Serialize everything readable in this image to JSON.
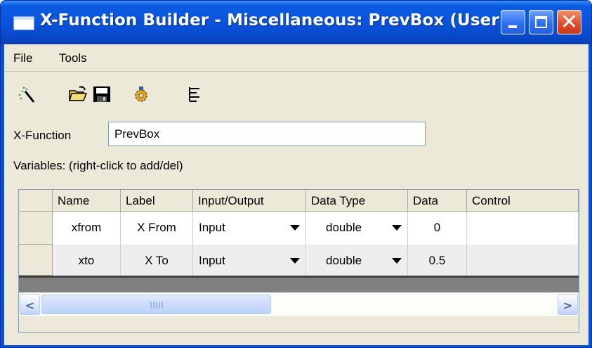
{
  "window": {
    "title": "X-Function Builder - Miscellaneous: PrevBox (User)"
  },
  "menu": [
    "File",
    "Tools"
  ],
  "toolbar": {
    "icons": [
      "wand-icon",
      "open-folder-icon",
      "save-icon",
      "gear-icon",
      "tree-view-icon"
    ]
  },
  "xfunction": {
    "label": "X-Function",
    "value": "PrevBox"
  },
  "variables_label": "Variables: (right-click to add/del)",
  "grid": {
    "columns": [
      "Name",
      "Label",
      "Input/Output",
      "Data Type",
      "Data",
      "Control"
    ],
    "rows": [
      {
        "name": "xfrom",
        "label": "X From",
        "io": "Input",
        "type": "double",
        "data": "0",
        "control": ""
      },
      {
        "name": "xto",
        "label": "X To",
        "io": "Input",
        "type": "double",
        "data": "0.5",
        "control": ""
      }
    ]
  },
  "colors": {
    "titlebar": "#0a52db",
    "client": "#ece9d8",
    "close_button": "#e0502d"
  }
}
